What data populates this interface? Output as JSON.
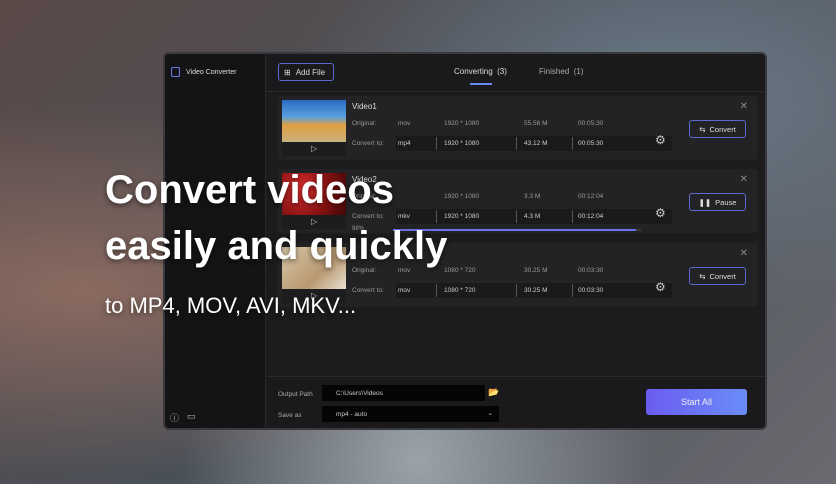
{
  "app": {
    "title": "Video Converter",
    "add_file": "Add File"
  },
  "tabs": [
    {
      "label": "Converting",
      "count": "(3)"
    },
    {
      "label": "Finished",
      "count": "(1)"
    }
  ],
  "labels": {
    "original": "Original:",
    "convert_to": "Convert to:"
  },
  "videos": [
    {
      "name": "Video1",
      "orig": [
        "mov",
        "1920 * 1080",
        "55.56 M",
        "00:05:30"
      ],
      "conv": [
        "mp4",
        "1920 * 1080",
        "43.12 M",
        "00:05:30"
      ],
      "action": "Convert",
      "action_icon": "swap-icon"
    },
    {
      "name": "Video2",
      "orig": [
        "",
        "1920 * 1080",
        "3.3 M",
        "00:12:04"
      ],
      "conv": [
        "mkv",
        "1920 * 1080",
        "4.3 M",
        "00:12:04"
      ],
      "action": "Pause",
      "action_icon": "pause-icon",
      "progress_label": "98%",
      "progress": 98
    },
    {
      "name": "",
      "orig": [
        "mov",
        "1080 * 720",
        "30.25 M",
        "00:03:30"
      ],
      "conv": [
        "mov",
        "1080 * 720",
        "30.25 M",
        "00:03:30"
      ],
      "action": "Convert",
      "action_icon": "swap-icon"
    }
  ],
  "footer": {
    "output_label": "Output Path",
    "output_value": "C:\\Users\\Videos",
    "save_label": "Save as",
    "save_value": "mp4 - auto",
    "start_all": "Start All"
  },
  "overlay": {
    "line1": "Convert videos",
    "line2": "easily and quickly",
    "line3": "to MP4, MOV, AVI, MKV..."
  },
  "colors": {
    "accent": "#6a70e8"
  }
}
